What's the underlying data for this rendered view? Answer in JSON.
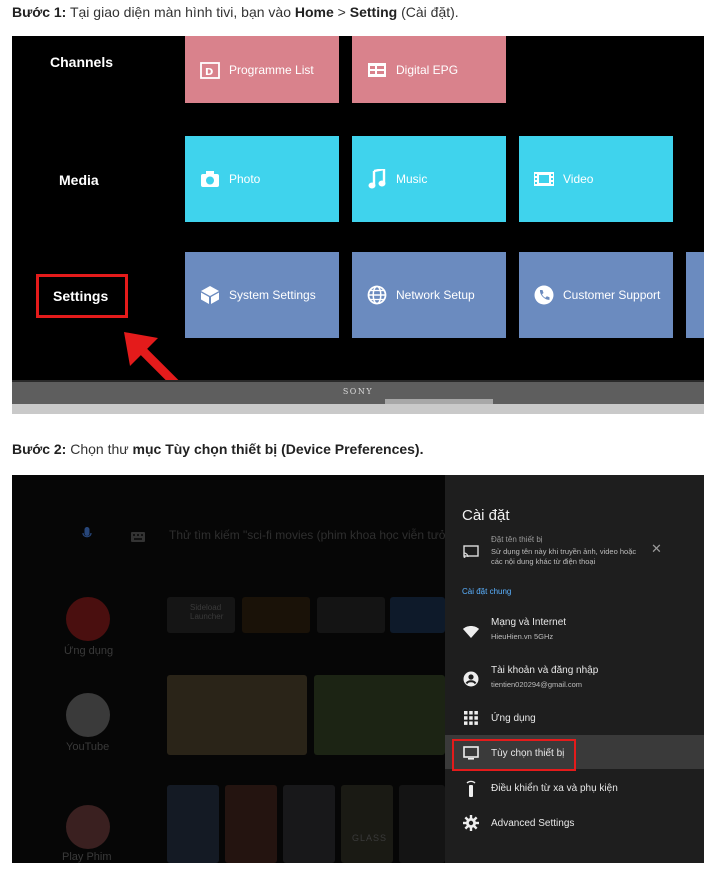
{
  "step1": {
    "prefix": "Bước 1:",
    "text_a": " Tại giao diện màn hình tivi, bạn vào ",
    "bold_a": "Home",
    "text_b": " > ",
    "bold_b": "Setting",
    "text_c": " (Cài đặt)."
  },
  "tv1": {
    "rows": [
      "Channels",
      "Media",
      "Settings"
    ],
    "tiles": {
      "programme_list": "Programme List",
      "digital_epg": "Digital EPG",
      "photo": "Photo",
      "music": "Music",
      "video": "Video",
      "system_settings": "System Settings",
      "network_setup": "Network Setup",
      "customer_support": "Customer Support"
    },
    "brand": "SONY",
    "colors": {
      "pink": "#d9828c",
      "cyan": "#3fd3ed",
      "blue": "#6b8bbf",
      "highlight": "#e41b1b"
    }
  },
  "step2": {
    "prefix": "Bước 2:",
    "text_a": " Chọn thư ",
    "bold_a": "mục Tùy chọn thiết bị (Device Preferences)."
  },
  "tv2": {
    "background": {
      "search_hint": "Thử tìm kiếm \"sci-fi movies (phim khoa học viễn tưởng)\"",
      "apps_label": "Ứng dụng",
      "youtube_label": "YouTube",
      "play_label": "Play Phim",
      "sideload_label": "Sideload Launcher",
      "glass_label": "GLASS"
    },
    "panel": {
      "title": "Cài đặt",
      "cast_title": "Đặt tên thiết bị",
      "cast_desc_1": "Sử dụng tên này khi truyền ảnh, video hoặc",
      "cast_desc_2": "các nội dung khác từ điện thoại",
      "section_label": "Cài đặt chung",
      "network": "Mạng và Internet",
      "network_sub": "HieuHien.vn 5GHz",
      "account": "Tài khoản và đăng nhập",
      "account_sub": "tientien020294@gmail.com",
      "apps": "Ứng dụng",
      "device_prefs": "Tùy chọn thiết bị",
      "remotes": "Điều khiển từ xa và phụ kiện",
      "advanced": "Advanced Settings"
    }
  }
}
